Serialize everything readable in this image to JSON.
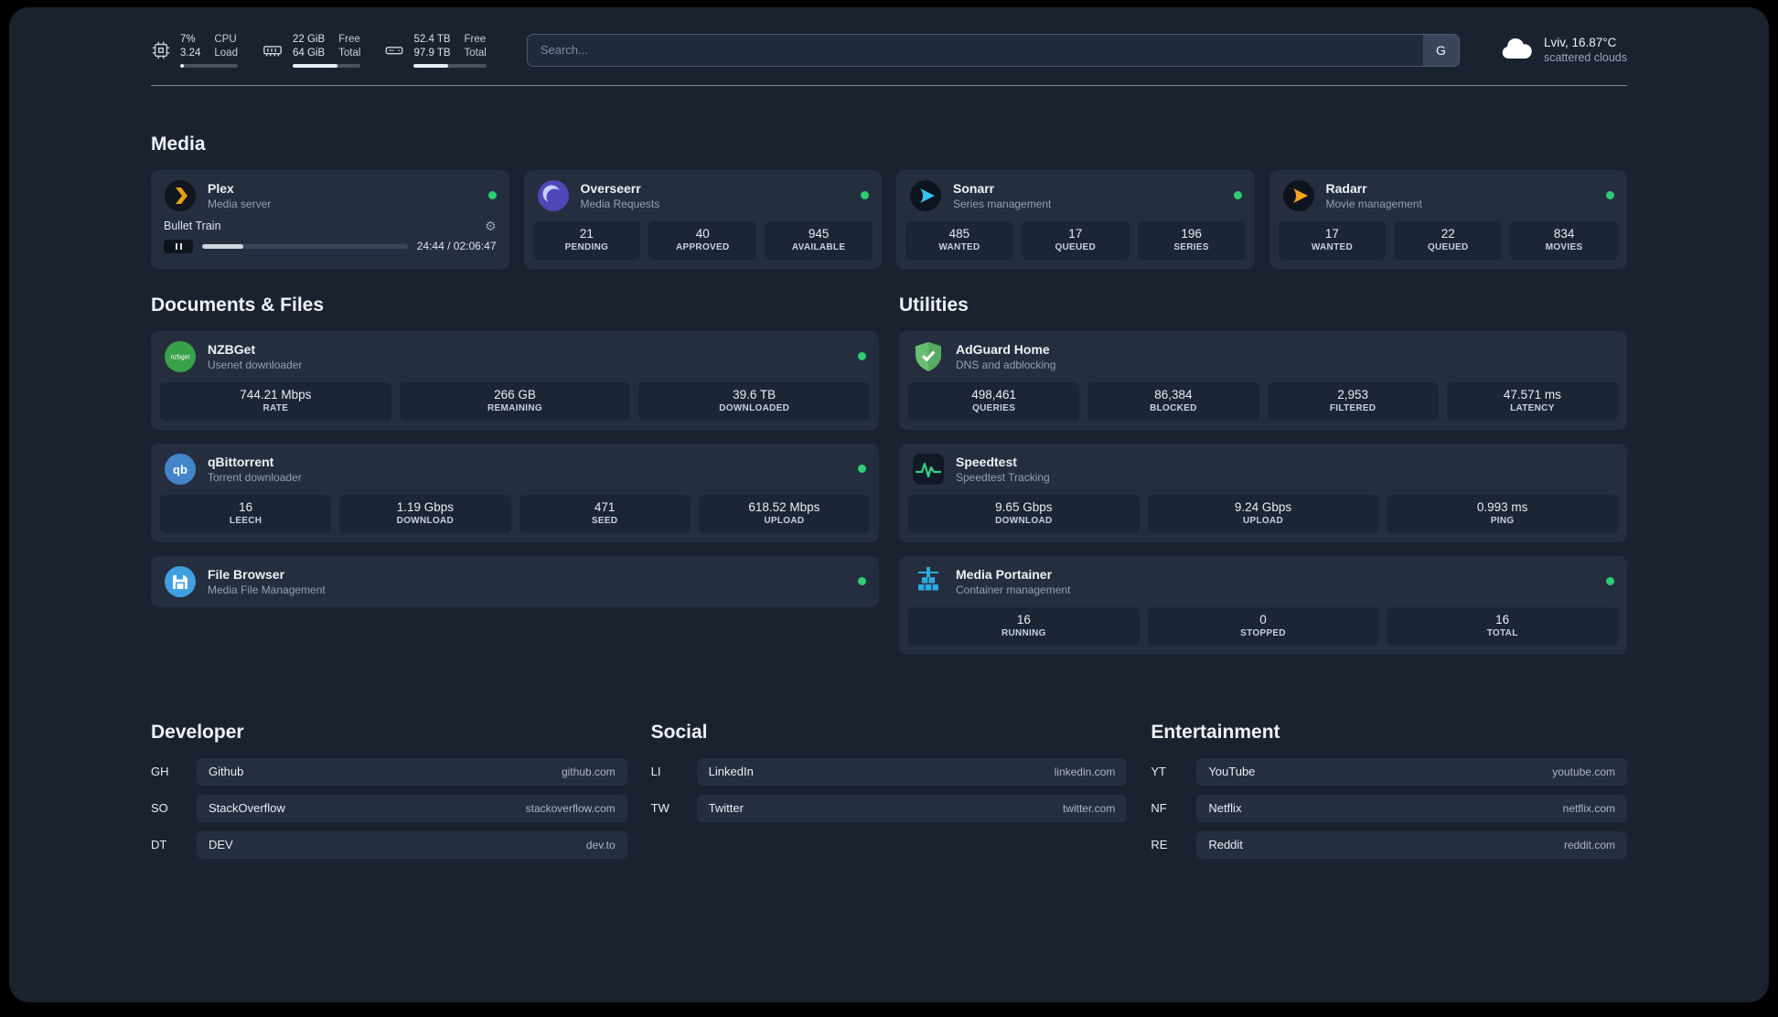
{
  "colors": {
    "accent_green": "#2ecc71",
    "plex_amber": "#e5a00d",
    "sonarr_blue": "#38c0f0",
    "radarr_amber": "#f5a623"
  },
  "topbar": {
    "cpu": {
      "value_top": "7%",
      "value_bottom": "3.24",
      "label_top": "CPU",
      "label_bottom": "Load",
      "progress": 7
    },
    "memory": {
      "value_top": "22 GiB",
      "value_bottom": "64 GiB",
      "label_top": "Free",
      "label_bottom": "Total",
      "progress": 66
    },
    "disk": {
      "value_top": "52.4 TB",
      "value_bottom": "97.9 TB",
      "label_top": "Free",
      "label_bottom": "Total",
      "progress": 47
    },
    "search": {
      "placeholder": "Search...",
      "button_label": "G"
    },
    "weather": {
      "location": "Lviv, 16.87°C",
      "condition": "scattered clouds"
    }
  },
  "media": {
    "title": "Media",
    "plex": {
      "name": "Plex",
      "subtitle": "Media server",
      "track": "Bullet Train",
      "time": "24:44 / 02:06:47",
      "progress": 20
    },
    "overseerr": {
      "name": "Overseerr",
      "subtitle": "Media Requests",
      "stats": [
        {
          "value": "21",
          "label": "PENDING"
        },
        {
          "value": "40",
          "label": "APPROVED"
        },
        {
          "value": "945",
          "label": "AVAILABLE"
        }
      ]
    },
    "sonarr": {
      "name": "Sonarr",
      "subtitle": "Series management",
      "stats": [
        {
          "value": "485",
          "label": "WANTED"
        },
        {
          "value": "17",
          "label": "QUEUED"
        },
        {
          "value": "196",
          "label": "SERIES"
        }
      ]
    },
    "radarr": {
      "name": "Radarr",
      "subtitle": "Movie management",
      "stats": [
        {
          "value": "17",
          "label": "WANTED"
        },
        {
          "value": "22",
          "label": "QUEUED"
        },
        {
          "value": "834",
          "label": "MOVIES"
        }
      ]
    }
  },
  "documents": {
    "title": "Documents & Files",
    "nzbget": {
      "name": "NZBGet",
      "subtitle": "Usenet downloader",
      "stats": [
        {
          "value": "744.21 Mbps",
          "label": "RATE"
        },
        {
          "value": "266 GB",
          "label": "REMAINING"
        },
        {
          "value": "39.6 TB",
          "label": "DOWNLOADED"
        }
      ]
    },
    "qbittorrent": {
      "name": "qBittorrent",
      "subtitle": "Torrent downloader",
      "stats": [
        {
          "value": "16",
          "label": "LEECH"
        },
        {
          "value": "1.19 Gbps",
          "label": "DOWNLOAD"
        },
        {
          "value": "471",
          "label": "SEED"
        },
        {
          "value": "618.52 Mbps",
          "label": "UPLOAD"
        }
      ]
    },
    "filebrowser": {
      "name": "File Browser",
      "subtitle": "Media File Management"
    }
  },
  "utilities": {
    "title": "Utilities",
    "adguard": {
      "name": "AdGuard Home",
      "subtitle": "DNS and adblocking",
      "stats": [
        {
          "value": "498,461",
          "label": "QUERIES"
        },
        {
          "value": "86,384",
          "label": "BLOCKED"
        },
        {
          "value": "2,953",
          "label": "FILTERED"
        },
        {
          "value": "47.571 ms",
          "label": "LATENCY"
        }
      ]
    },
    "speedtest": {
      "name": "Speedtest",
      "subtitle": "Speedtest Tracking",
      "stats": [
        {
          "value": "9.65 Gbps",
          "label": "DOWNLOAD"
        },
        {
          "value": "9.24 Gbps",
          "label": "UPLOAD"
        },
        {
          "value": "0.993 ms",
          "label": "PING"
        }
      ]
    },
    "portainer": {
      "name": "Media Portainer",
      "subtitle": "Container management",
      "stats": [
        {
          "value": "16",
          "label": "RUNNING"
        },
        {
          "value": "0",
          "label": "STOPPED"
        },
        {
          "value": "16",
          "label": "TOTAL"
        }
      ]
    }
  },
  "bookmarks": {
    "developer": {
      "title": "Developer",
      "items": [
        {
          "abbr": "GH",
          "name": "Github",
          "url": "github.com"
        },
        {
          "abbr": "SO",
          "name": "StackOverflow",
          "url": "stackoverflow.com"
        },
        {
          "abbr": "DT",
          "name": "DEV",
          "url": "dev.to"
        }
      ]
    },
    "social": {
      "title": "Social",
      "items": [
        {
          "abbr": "LI",
          "name": "LinkedIn",
          "url": "linkedin.com"
        },
        {
          "abbr": "TW",
          "name": "Twitter",
          "url": "twitter.com"
        }
      ]
    },
    "entertainment": {
      "title": "Entertainment",
      "items": [
        {
          "abbr": "YT",
          "name": "YouTube",
          "url": "youtube.com"
        },
        {
          "abbr": "NF",
          "name": "Netflix",
          "url": "netflix.com"
        },
        {
          "abbr": "RE",
          "name": "Reddit",
          "url": "reddit.com"
        }
      ]
    }
  }
}
